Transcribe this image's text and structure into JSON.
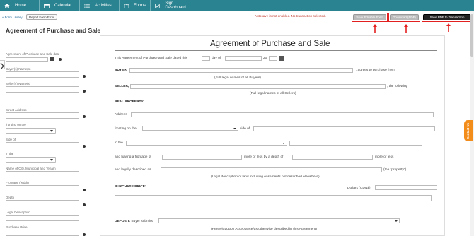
{
  "nav": {
    "items": [
      {
        "label": "Home",
        "icon": "home-icon"
      },
      {
        "label": "Calendar",
        "icon": "calendar-icon"
      },
      {
        "label": "Activities",
        "icon": "list-icon"
      },
      {
        "label": "Forms",
        "icon": "folder-icon"
      },
      {
        "label": "Sign Dashboard",
        "icon": "pen-icon"
      }
    ]
  },
  "toolbar": {
    "autosave": "Autosave is not enabled. No transaction selected.",
    "save_button": "Save Editable Form",
    "download_button": "Download (PDF)",
    "save_pdf_button": "Save PDF to Transaction"
  },
  "colors": {
    "nav": "#2a8390",
    "highlight": "#e22020",
    "contact": "#f28c1b"
  },
  "breadcrumb": {
    "form_library": "Form Library",
    "report_error": "Report Form Error"
  },
  "page_title": "Agreement of Purchase and Sale",
  "sidebar": {
    "fields": [
      {
        "label": "Agreement of Purchase and Sale date"
      },
      {
        "label": "Buyer(s) Name(s)"
      },
      {
        "label": "Seller(s) Name(s)"
      },
      {
        "label": "Street Address"
      },
      {
        "label": "fronting on the"
      },
      {
        "label": "Side of"
      },
      {
        "label": "In the"
      },
      {
        "label": "Name of City, Municipal and Tenam"
      },
      {
        "label": "Frontage (width)"
      },
      {
        "label": "Depth"
      },
      {
        "label": "Legal Description"
      },
      {
        "label": "Purchase Price"
      }
    ]
  },
  "doc": {
    "title": "Agreement of Purchase and Sale",
    "dated": "This Agreement of Purchase and Sale dated this",
    "day_of": "day of",
    "year_prefix": "20",
    "buyer": "BUYER,",
    "buyer_suffix": ", agrees to purchase from",
    "buyer_note": "(Full legal names of all Buyers)",
    "seller": "SELLER,",
    "seller_suffix": ", the following",
    "seller_note": "(Full legal names of all Sellers)",
    "real_property": "REAL PROPERTY:",
    "address": "Address",
    "fronting": "fronting on the",
    "side_of": "side of",
    "in_the": "in the",
    "frontage": "and having a frontage of",
    "depth": "more or less by a depth of",
    "more_or_less": "more or less",
    "legally": "and legally described as",
    "property": "(the \"property\").",
    "legal_note": "(Legal description of land including easements not described elsewhere)",
    "purchase_price": "PURCHASE PRICE:",
    "dollars": "Dollars (CDN$)",
    "deposit": "DEPOSIT:",
    "buyer_submits": "Buyer submits",
    "deposit_note": "(Herewith/Upon Acceptance/as otherwise described in this Agreement)"
  },
  "contact_us": "Contact Us"
}
